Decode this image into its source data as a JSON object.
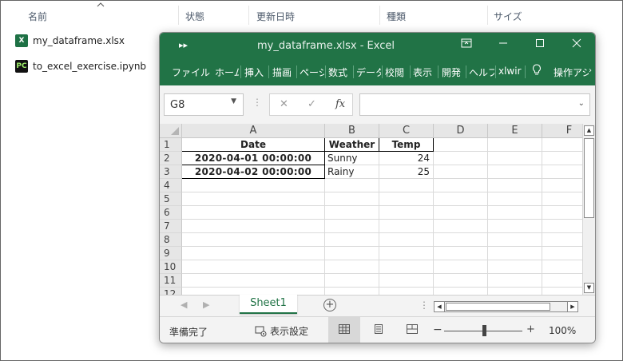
{
  "explorer": {
    "columns": [
      "名前",
      "状態",
      "更新日時",
      "種類",
      "サイズ"
    ],
    "files": [
      {
        "name": "my_dataframe.xlsx",
        "icon": "excel-file-icon"
      },
      {
        "name": "to_excel_exercise.ipynb",
        "icon": "pycharm-file-icon"
      }
    ]
  },
  "excel": {
    "title": "my_dataframe.xlsx  -  Excel",
    "quick_access": "▸▸",
    "tabs": [
      "ファイル",
      "ホーム",
      "挿入",
      "描画",
      "ページ",
      "数式",
      "データ",
      "校閲",
      "表示",
      "開発",
      "ヘルプ",
      "xlwir",
      "操作アシ"
    ],
    "lightbulb_icon": "lightbulb-icon",
    "name_box": "G8",
    "formula": "",
    "col_headers": [
      "A",
      "B",
      "C",
      "D",
      "E",
      "F"
    ],
    "row_headers": [
      "1",
      "2",
      "3",
      "4",
      "5",
      "6",
      "7",
      "8",
      "9",
      "10",
      "11",
      "12"
    ],
    "table": {
      "headers": [
        "Date",
        "Weather",
        "Temp"
      ],
      "rows": [
        [
          "2020-04-01 00:00:00",
          "Sunny",
          "24"
        ],
        [
          "2020-04-02 00:00:00",
          "Rainy",
          "25"
        ]
      ]
    },
    "sheet_tab": "Sheet1",
    "status": "準備完了",
    "display_settings": "表示設定",
    "zoom": "100%",
    "zoom_minus": "−",
    "zoom_plus": "+",
    "accent_color": "#217346"
  }
}
